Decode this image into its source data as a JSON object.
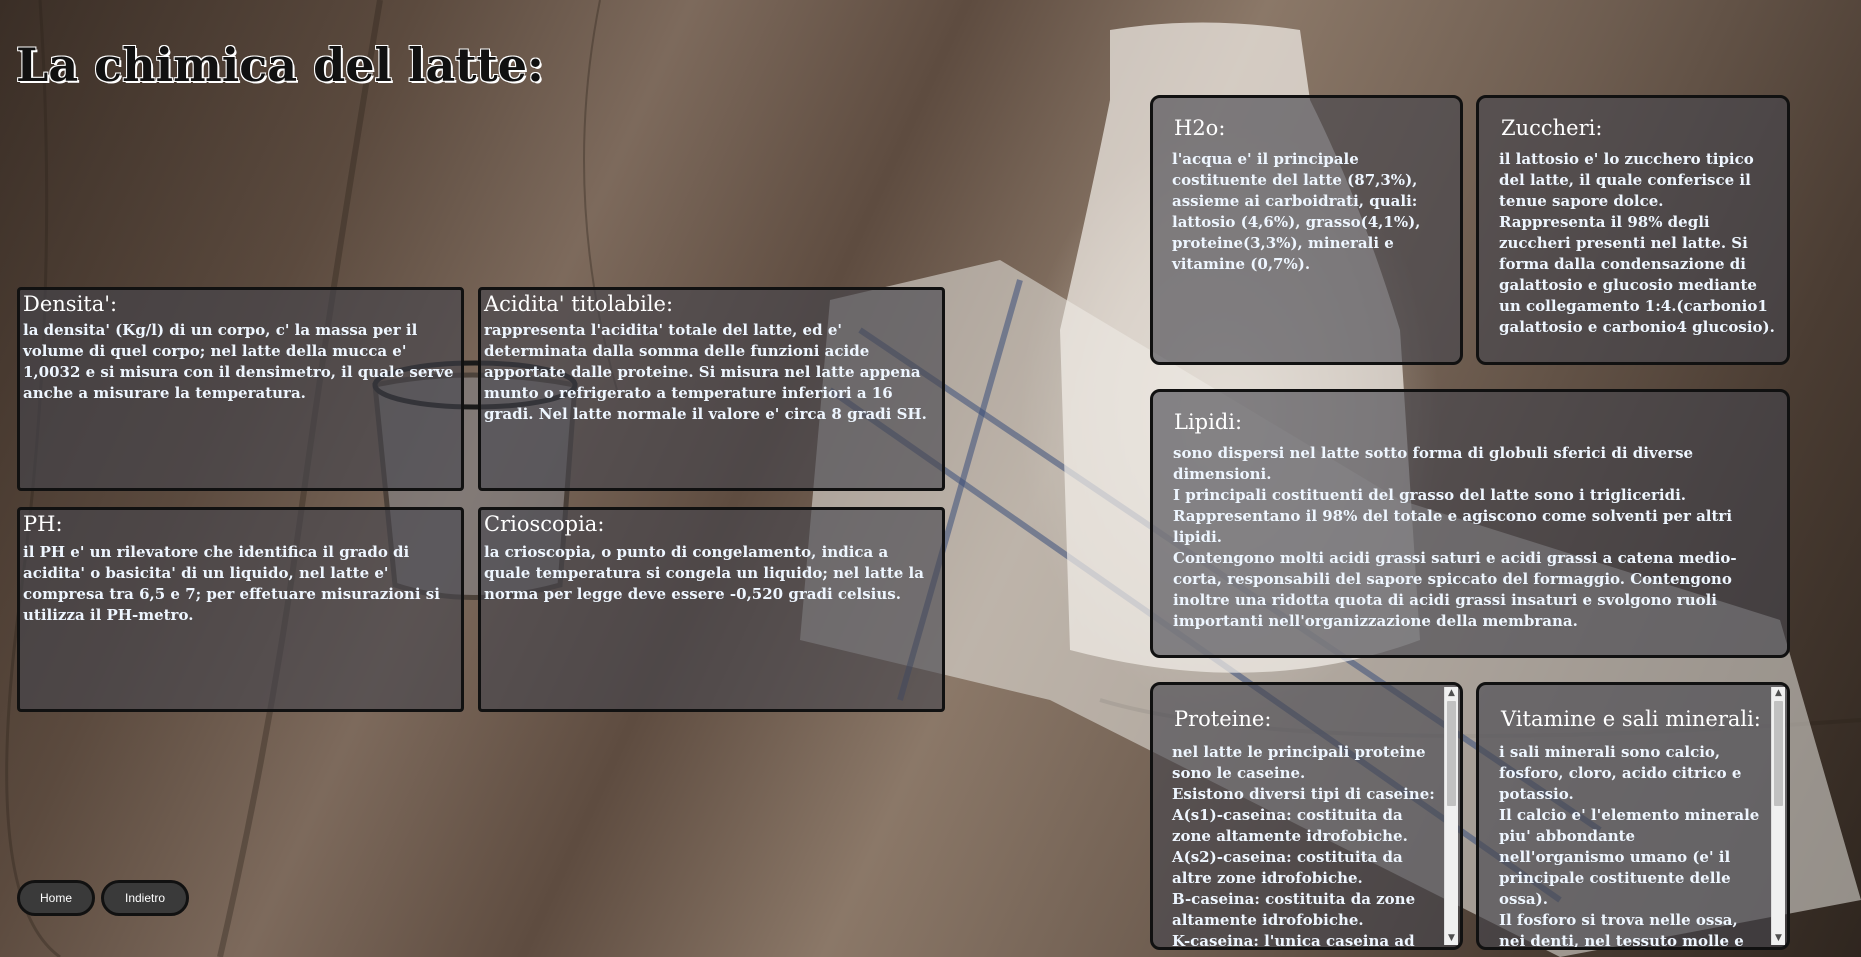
{
  "page": {
    "title": "La chimica del latte:"
  },
  "cards": {
    "densita": {
      "title": "Densita':",
      "text": "la densita' (Kg/l) di un corpo, c' la massa per il volume di quel corpo; nel latte della mucca e' 1,0032 e si misura con il densimetro, il quale serve anche a misurare la temperatura."
    },
    "acidita": {
      "title": "Acidita' titolabile:",
      "text": "rappresenta l'acidita' totale del latte, ed e' determinata dalla somma delle funzioni acide apportate dalle proteine. Si misura nel latte appena munto o refrigerato a temperature inferiori a 16 gradi. Nel latte normale il valore e' circa 8 gradi SH."
    },
    "ph": {
      "title": "PH:",
      "text": "il PH e' un rilevatore che identifica il grado di acidita' o basicita' di un liquido, nel latte e' compresa tra 6,5 e 7; per effetuare misurazioni si utilizza il PH-metro."
    },
    "crioscopia": {
      "title": "Crioscopia:",
      "text": "la crioscopia, o punto di congelamento, indica a quale temperatura si congela un liquido; nel latte la norma per legge deve essere -0,520 gradi celsius."
    },
    "h2o": {
      "title": "H2o:",
      "text": "l'acqua e' il principale costituente del latte (87,3%), assieme ai carboidrati, quali: lattosio (4,6%), grasso(4,1%), proteine(3,3%), minerali e vitamine (0,7%)."
    },
    "zuccheri": {
      "title": "Zuccheri:",
      "text": "il lattosio e' lo zucchero tipico del latte, il quale conferisce il tenue sapore dolce.\nRappresenta il 98% degli zuccheri presenti nel latte. Si forma dalla condensazione di galattosio e glucosio mediante un collegamento 1:4.(carbonio1 galattosio e carbonio4 glucosio)."
    },
    "lipidi": {
      "title": "Lipidi:",
      "text": "sono dispersi nel latte sotto forma di globuli sferici di diverse dimensioni.\nI principali costituenti del grasso del latte sono i trigliceridi.\nRappresentano il 98% del totale e agiscono come solventi per altri lipidi.\nContengono molti acidi grassi saturi e acidi grassi a catena medio-corta, responsabili del sapore spiccato del formaggio. Contengono inoltre una ridotta quota di acidi grassi insaturi e svolgono ruoli importanti nell'organizzazione della membrana."
    },
    "proteine": {
      "title": "Proteine:",
      "text": "nel latte le principali proteine sono le caseine.\nEsistono diversi tipi di caseine:\nA(s1)-caseina: costituita da zone altamente idrofobiche.\nA(s2)-caseina: costituita da altre zone idrofobiche.\nB-caseina: costituita da zone altamente idrofobiche.\nK-caseina: l'unica caseina ad"
    },
    "vitamine": {
      "title": "Vitamine e sali minerali:",
      "text": "i sali minerali sono calcio, fosforo, cloro, acido citrico e potassio.\nIl calcio e' l'elemento minerale piu' abbondante nell'organismo umano (e' il principale costituente delle ossa).\nIl fosforo si trova nelle ossa, nei denti, nel tessuto molle e nel sangue.\nIl cloro e' fondamentale nella"
    }
  },
  "nav": {
    "home": "Home",
    "back": "Indietro"
  },
  "icons": {
    "scroll_up": "▲",
    "scroll_down": "▼"
  }
}
